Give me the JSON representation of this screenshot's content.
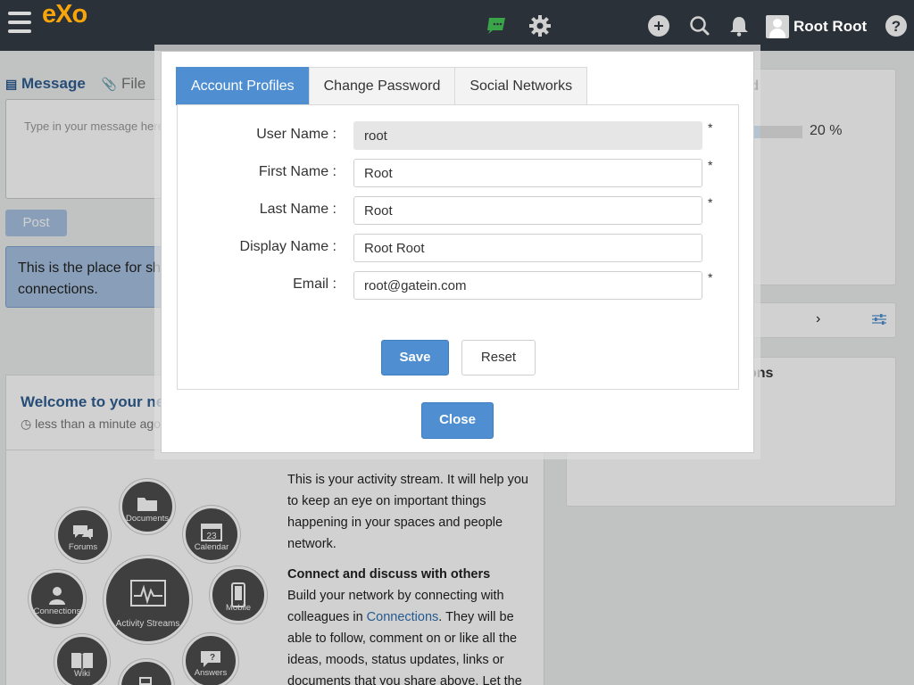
{
  "navbar": {
    "logo": "eXo",
    "user_name": "Root Root"
  },
  "composer": {
    "tab_message": "Message",
    "tab_file": "File",
    "placeholder": "Type in your message here...",
    "post_label": "Post",
    "info_text": "This is the place for sharing with your connections."
  },
  "activity": {
    "title": "Welcome to your new social intranet!",
    "time": "less than a minute ago",
    "bubbles": [
      "Documents",
      "Forums",
      "Calendar",
      "Activity Streams",
      "Connections",
      "Mobile",
      "Wiki",
      "Answers"
    ],
    "calendar_day": "23",
    "para1": "This is your activity stream. It will help you to keep an eye on important things happening in your spaces and people network.",
    "heading": "Connect and discuss with others",
    "para2_before": "Build your network by connecting with colleagues in ",
    "para2_link": "Connections",
    "para2_after": ". They will be able to follow, comment on or like all the ideas, moods, status updates, links or documents that you share above. Let the"
  },
  "right_panel": {
    "getting_started_title": "rted",
    "progress_percent": 20,
    "progress_label": "20 %",
    "suggestions_title": "ons"
  },
  "modal": {
    "tabs": [
      "Account Profiles",
      "Change Password",
      "Social Networks"
    ],
    "active_tab": "Account Profiles",
    "fields": {
      "username": {
        "label": "User Name :",
        "value": "root",
        "required": "*"
      },
      "firstname": {
        "label": "First Name :",
        "value": "Root",
        "required": "*"
      },
      "lastname": {
        "label": "Last Name :",
        "value": "Root",
        "required": "*"
      },
      "displayname": {
        "label": "Display Name :",
        "value": "Root Root"
      },
      "email": {
        "label": "Email :",
        "value": "root@gatein.com",
        "required": "*"
      }
    },
    "save_label": "Save",
    "reset_label": "Reset",
    "close_label": "Close"
  },
  "colors": {
    "navbar_bg": "#2a3138",
    "logo": "#f7a50a",
    "primary": "#4f8fd1",
    "chat_icon": "#3aa548"
  }
}
